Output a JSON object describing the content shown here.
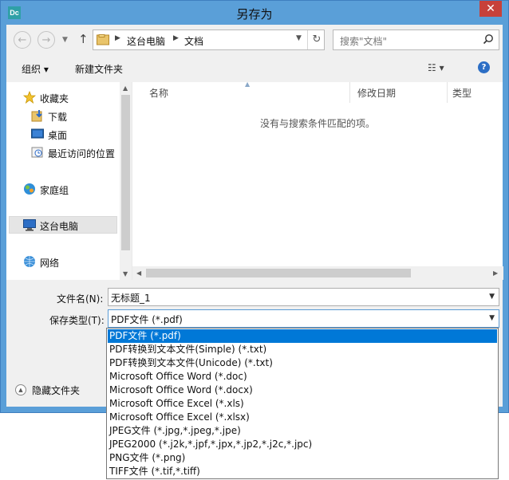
{
  "window": {
    "title": "另存为",
    "app_icon_text": "Dc",
    "close_glyph": "✕"
  },
  "nav": {
    "back_glyph": "←",
    "forward_glyph": "→",
    "up_glyph": "↑",
    "breadcrumb": [
      "这台电脑",
      "文档"
    ],
    "refresh_glyph": "↻",
    "search_placeholder": "搜索\"文档\""
  },
  "toolbar": {
    "organize_label": "组织 ▾",
    "new_folder_label": "新建文件夹",
    "view_glyph": "☷ ▾",
    "help_glyph": "?"
  },
  "sidebar": {
    "items": [
      {
        "label": "收藏夹",
        "icon": "star-icon"
      },
      {
        "label": "下载",
        "icon": "download-folder-icon"
      },
      {
        "label": "桌面",
        "icon": "desktop-icon"
      },
      {
        "label": "最近访问的位置",
        "icon": "recent-places-icon"
      },
      {
        "label": "家庭组",
        "icon": "homegroup-icon"
      },
      {
        "label": "这台电脑",
        "icon": "this-pc-icon"
      },
      {
        "label": "网络",
        "icon": "network-icon"
      }
    ]
  },
  "file_list": {
    "columns": [
      "名称",
      "修改日期",
      "类型"
    ],
    "empty_message": "没有与搜索条件匹配的项。"
  },
  "form": {
    "filename_label": "文件名(N):",
    "filename_value": "无标题_1",
    "filetype_label": "保存类型(T):",
    "filetype_value": "PDF文件 (*.pdf)"
  },
  "footer": {
    "hide_folders_label": "隐藏文件夹"
  },
  "filetype_options": [
    "PDF文件 (*.pdf)",
    "PDF转换到文本文件(Simple) (*.txt)",
    "PDF转换到文本文件(Unicode) (*.txt)",
    "Microsoft Office Word (*.doc)",
    "Microsoft Office Word (*.docx)",
    "Microsoft Office Excel (*.xls)",
    "Microsoft Office Excel (*.xlsx)",
    "JPEG文件 (*.jpg,*.jpeg,*.jpe)",
    "JPEG2000 (*.j2k,*.jpf,*.jpx,*.jp2,*.j2c,*.jpc)",
    "PNG文件 (*.png)",
    "TIFF文件 (*.tif,*.tiff)"
  ],
  "colors": {
    "titlebar": "#5a9fd8",
    "close": "#c7413a",
    "selection": "#0078d7"
  }
}
